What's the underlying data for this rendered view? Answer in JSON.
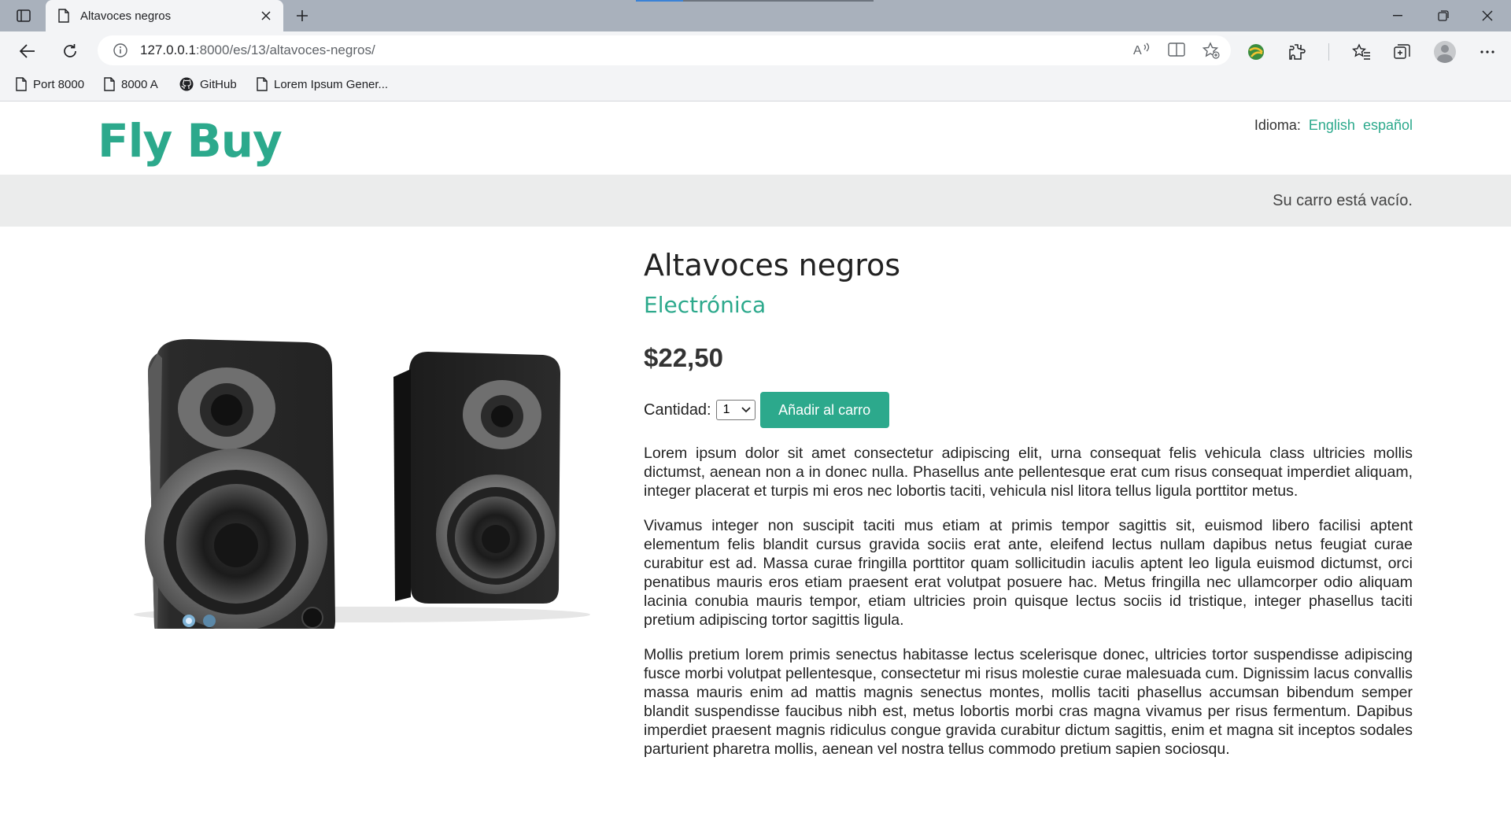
{
  "browser": {
    "tab_title": "Altavoces negros",
    "url_host": "127.0.0.1",
    "url_path": ":8000/es/13/altavoces-negros/",
    "bookmarks": [
      {
        "label": "Port 8000",
        "icon": "page-icon"
      },
      {
        "label": "8000 A",
        "icon": "page-icon"
      },
      {
        "label": "GitHub",
        "icon": "github-icon"
      },
      {
        "label": "Lorem Ipsum Gener...",
        "icon": "page-icon"
      }
    ]
  },
  "site": {
    "logo": "Fly Buy",
    "language_label": "Idioma:",
    "languages": [
      "English",
      "español"
    ],
    "cart_status": "Su carro está vacío."
  },
  "product": {
    "name": "Altavoces negros",
    "category": "Electrónica",
    "price": "$22,50",
    "quantity_label": "Cantidad:",
    "quantity_value": "1",
    "add_button": "Añadir al carro",
    "description": [
      "Lorem ipsum dolor sit amet consectetur adipiscing elit, urna consequat felis vehicula class ultricies mollis dictumst, aenean non a in donec nulla. Phasellus ante pellentesque erat cum risus consequat imperdiet aliquam, integer placerat et turpis mi eros nec lobortis taciti, vehicula nisl litora tellus ligula porttitor metus.",
      "Vivamus integer non suscipit taciti mus etiam at primis tempor sagittis sit, euismod libero facilisi aptent elementum felis blandit cursus gravida sociis erat ante, eleifend lectus nullam dapibus netus feugiat curae curabitur est ad. Massa curae fringilla porttitor quam sollicitudin iaculis aptent leo ligula euismod dictumst, orci penatibus mauris eros etiam praesent erat volutpat posuere hac. Metus fringilla nec ullamcorper odio aliquam lacinia conubia mauris tempor, etiam ultricies proin quisque lectus sociis id tristique, integer phasellus taciti pretium adipiscing tortor sagittis ligula.",
      "Mollis pretium lorem primis senectus habitasse lectus scelerisque donec, ultricies tortor suspendisse adipiscing fusce morbi volutpat pellentesque, consectetur mi risus molestie curae malesuada cum. Dignissim lacus convallis massa mauris enim ad mattis magnis senectus montes, mollis taciti phasellus accumsan bibendum semper blandit suspendisse faucibus nibh est, metus lobortis morbi cras magna vivamus per risus fermentum. Dapibus imperdiet praesent magnis ridiculus congue gravida curabitur dictum sagittis, enim et magna sit inceptos sodales parturient pharetra mollis, aenean vel nostra tellus commodo pretium sapien sociosqu."
    ]
  },
  "colors": {
    "accent": "#2ca98c",
    "cartbar_bg": "#ebecec",
    "chrome_tabbar": "#a9b1bc",
    "chrome_toolbar": "#f3f4f6"
  }
}
